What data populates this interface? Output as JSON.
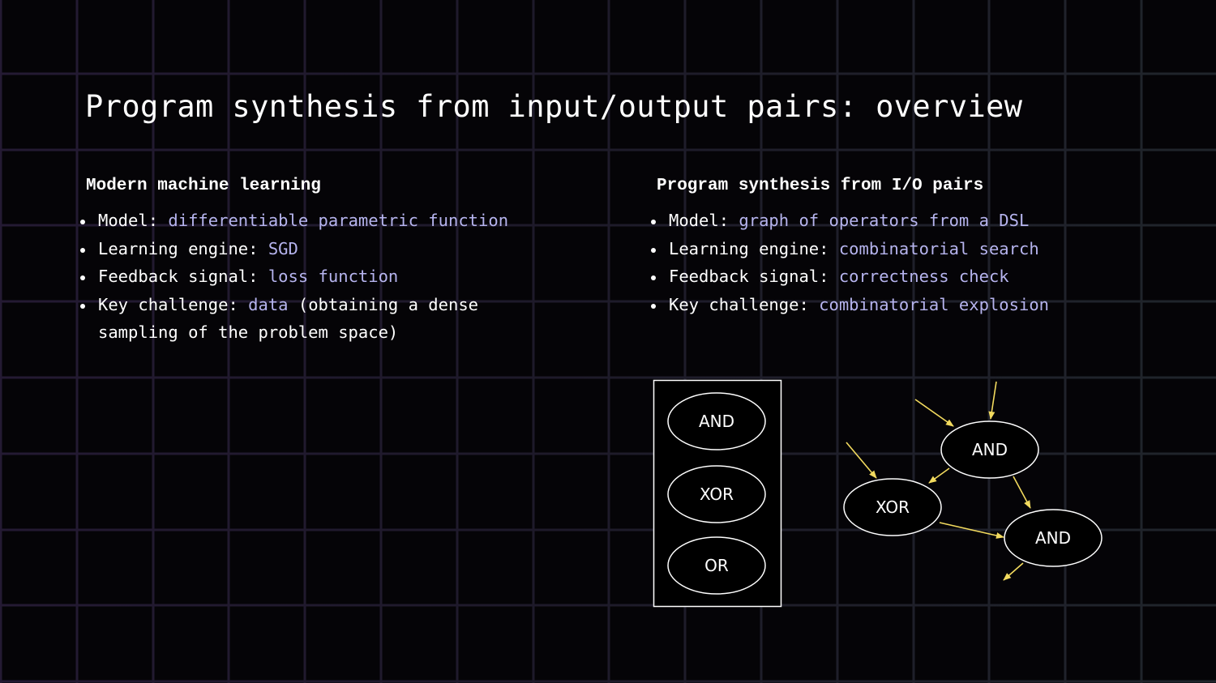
{
  "slide": {
    "title": "Program synthesis from input/output pairs: overview"
  },
  "columns": [
    {
      "heading": "Modern machine learning",
      "items": [
        {
          "label": "Model: ",
          "value": "differentiable parametric function",
          "suffix": ""
        },
        {
          "label": "Learning engine: ",
          "value": "SGD",
          "suffix": ""
        },
        {
          "label": "Feedback signal: ",
          "value": "loss function",
          "suffix": ""
        },
        {
          "label": "Key challenge: ",
          "value": "data",
          "suffix": " (obtaining a dense sampling of the problem space)"
        }
      ]
    },
    {
      "heading": "Program synthesis from I/O pairs",
      "items": [
        {
          "label": "Model: ",
          "value": "graph of operators from a DSL",
          "suffix": ""
        },
        {
          "label": "Learning engine: ",
          "value": "combinatorial search",
          "suffix": ""
        },
        {
          "label": "Feedback signal: ",
          "value": "correctness check",
          "suffix": ""
        },
        {
          "label": "Key challenge: ",
          "value": "combinatorial explosion",
          "suffix": ""
        }
      ]
    }
  ],
  "diagram": {
    "dsl_palette": {
      "operators": [
        "AND",
        "XOR",
        "OR"
      ]
    },
    "program_graph": {
      "nodes": [
        {
          "id": "and1",
          "label": "AND"
        },
        {
          "id": "xor1",
          "label": "XOR"
        },
        {
          "id": "and2",
          "label": "AND"
        }
      ],
      "edges": [
        {
          "from": "input",
          "to": "and1"
        },
        {
          "from": "input",
          "to": "and1"
        },
        {
          "from": "input",
          "to": "xor1"
        },
        {
          "from": "and1",
          "to": "xor1"
        },
        {
          "from": "and1",
          "to": "and2"
        },
        {
          "from": "xor1",
          "to": "and2"
        },
        {
          "from": "and2",
          "to": "output"
        }
      ]
    }
  },
  "colors": {
    "background": "#050407",
    "text": "#ffffff",
    "highlight": "#b6b4ee",
    "arrow": "#f2da5e",
    "grid_left": "#221a30",
    "grid_right": "#1f2328"
  }
}
